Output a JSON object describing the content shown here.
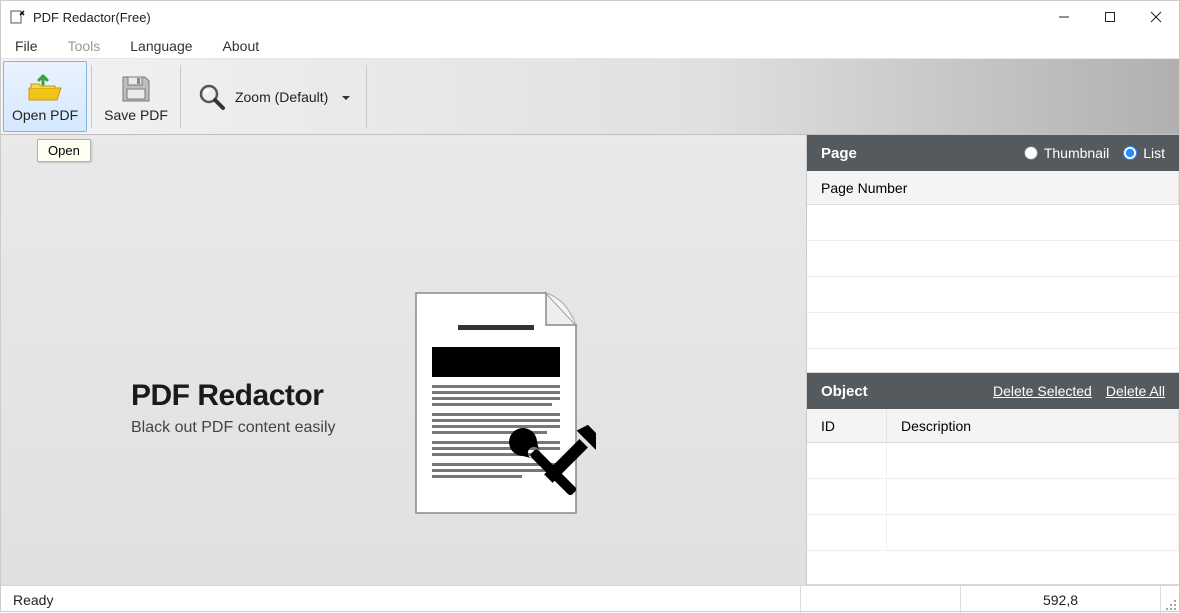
{
  "window": {
    "title": "PDF Redactor(Free)"
  },
  "menubar": {
    "items": [
      {
        "label": "File",
        "enabled": true
      },
      {
        "label": "Tools",
        "enabled": false
      },
      {
        "label": "Language",
        "enabled": true
      },
      {
        "label": "About",
        "enabled": true
      }
    ]
  },
  "toolbar": {
    "open_pdf": "Open PDF",
    "save_pdf": "Save PDF",
    "zoom": "Zoom (Default)"
  },
  "tooltip": "Open",
  "splash": {
    "title": "PDF Redactor",
    "subtitle": "Black out PDF content easily"
  },
  "page_panel": {
    "title": "Page",
    "view_thumbnail": "Thumbnail",
    "view_list": "List",
    "selected_view": "list",
    "columns": [
      "Page Number"
    ]
  },
  "object_panel": {
    "title": "Object",
    "delete_selected": "Delete Selected",
    "delete_all": "Delete All",
    "columns": [
      "ID",
      "Description"
    ]
  },
  "statusbar": {
    "ready": "Ready",
    "coords": "592,8"
  }
}
